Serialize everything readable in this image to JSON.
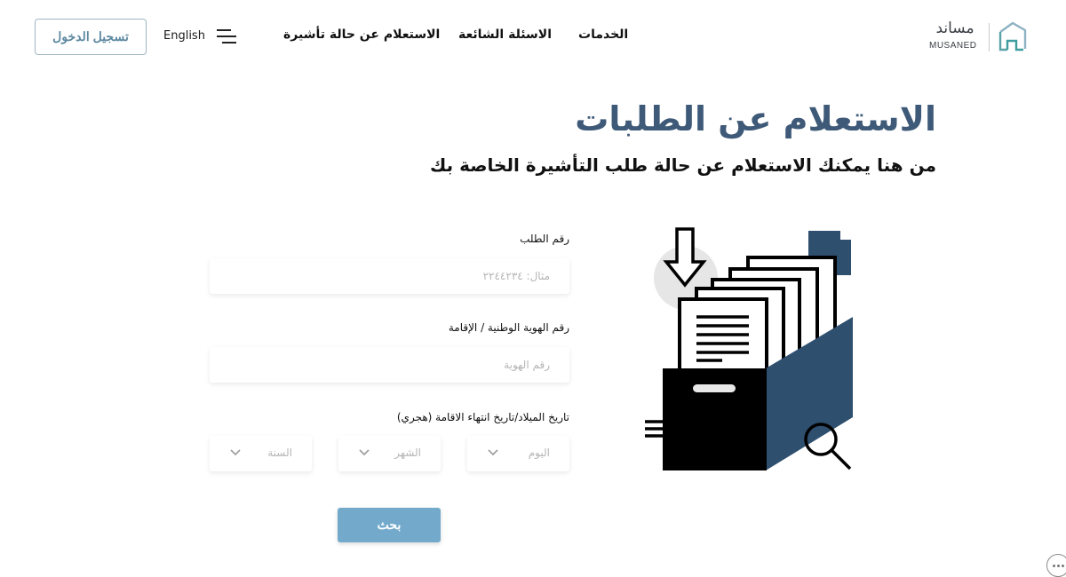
{
  "header": {
    "login_label": "تسجيل الدخول",
    "language_label": "English",
    "nav": {
      "services": "الخدمات",
      "faq": "الاسئلة الشائعة",
      "visa_status": "الاستعلام عن حالة تأشيرة"
    },
    "logo": {
      "arabic": "مساند",
      "english": "MUSANED"
    }
  },
  "hero": {
    "title": "الاستعلام عن الطلبات",
    "subtitle": "من هنا يمكنك الاستعلام عن حالة طلب التأشيرة الخاصة بك"
  },
  "form": {
    "request_number": {
      "label": "رقم الطلب",
      "placeholder": "مثال: ٢٢٤٤٢٣٤",
      "value": ""
    },
    "id_number": {
      "label": "رقم الهوية الوطنية / الإقامة",
      "placeholder": "رقم الهوية",
      "value": ""
    },
    "date": {
      "label": "تاريخ الميلاد/تاريخ انتهاء الاقامة (هجري)",
      "day": "اليوم",
      "month": "الشهر",
      "year": "السنة"
    },
    "search_label": "بحث"
  },
  "icons": {
    "menu": "hamburger-icon",
    "chevron": "chevron-down-icon",
    "chat": "chat-bubble-icon",
    "logo": "musaned-house-icon"
  },
  "colors": {
    "title": "#3e5a78",
    "accent_button": "#73aacb",
    "login_text": "#5e89a1",
    "box_side": "#2f4f6f"
  }
}
